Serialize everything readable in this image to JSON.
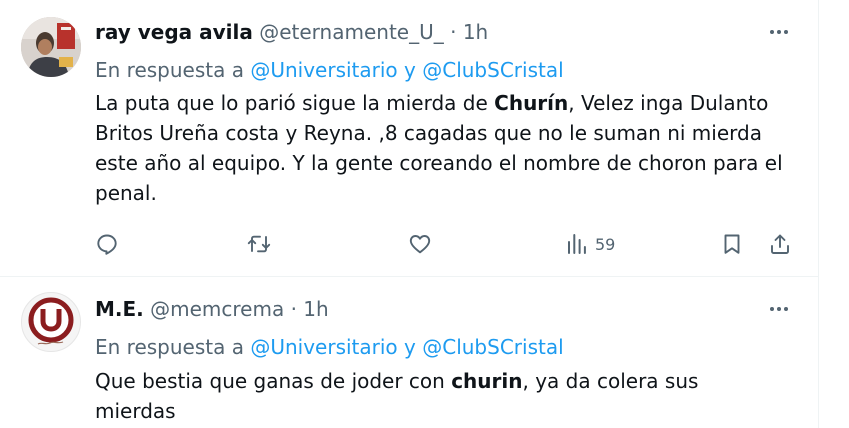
{
  "tweets": [
    {
      "name": "ray vega avila",
      "handle": "@eternamente_U_",
      "separator": "·",
      "time": "1h",
      "reply_prefix": "En respuesta a",
      "reply_user1": "@Universitario",
      "reply_conj": "y",
      "reply_user2": "@ClubSCristal",
      "body_before": "La puta que lo parió sigue la mierda de ",
      "body_bold": "Churín",
      "body_after": ", Velez inga Dulanto Britos Ureña costa y Reyna. ,8 cagadas que no le suman ni mierda este año al equipo. Y la gente coreando el nombre de choron para el penal.",
      "views": "59"
    },
    {
      "name": "M.E.",
      "handle": "@memcrema",
      "separator": "·",
      "time": "1h",
      "reply_prefix": "En respuesta a",
      "reply_user1": "@Universitario",
      "reply_conj": "y",
      "reply_user2": "@ClubSCristal",
      "body_before": "Que bestia que ganas de joder con ",
      "body_bold": "churin",
      "body_after": ", ya da colera sus mierdas"
    }
  ],
  "icons": {
    "more": "more-horizontal-icon",
    "reply": "reply-bubble-icon",
    "retweet": "retweet-icon",
    "like": "heart-icon",
    "views": "bar-chart-views-icon",
    "bookmark": "bookmark-icon",
    "share": "share-upload-icon"
  },
  "colors": {
    "link": "#1d9bf0",
    "secondary_text": "#536471",
    "primary_text": "#0f1419",
    "border": "#eff3f4"
  }
}
